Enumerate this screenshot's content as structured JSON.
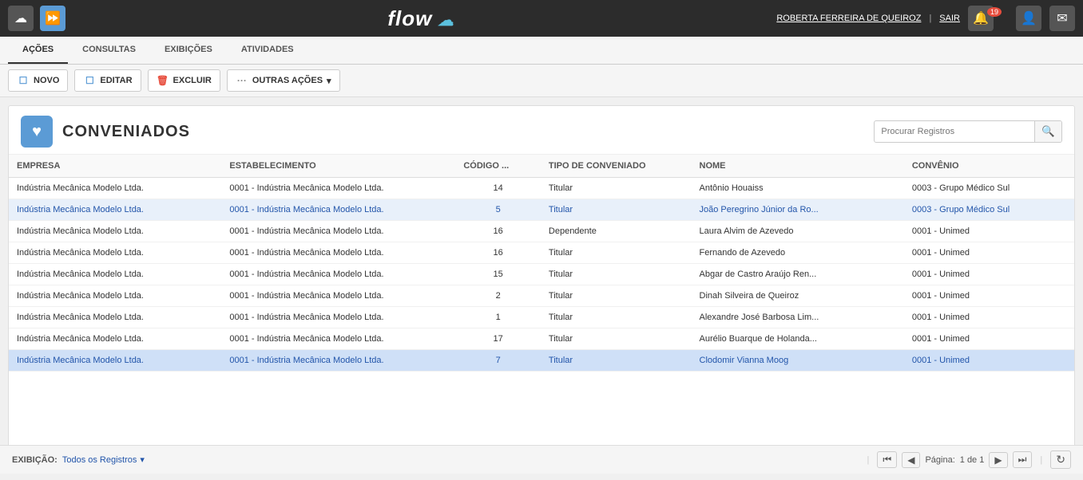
{
  "topbar": {
    "logo": "flow",
    "logo_icon": "☁",
    "user_name": "ROBERTA FERREIRA DE QUEIROZ",
    "sair_label": "SAIR",
    "notification_count": "19"
  },
  "nav": {
    "tabs": [
      {
        "label": "AÇÕES",
        "active": false
      },
      {
        "label": "CONSULTAS",
        "active": false
      },
      {
        "label": "EXIBIÇÕES",
        "active": false
      },
      {
        "label": "ATIVIDADES",
        "active": false
      }
    ]
  },
  "toolbar": {
    "novo_label": "NOVO",
    "editar_label": "EDITAR",
    "excluir_label": "EXCLUIR",
    "outras_acoes_label": "OUTRAS AÇÕES"
  },
  "page": {
    "icon": "♥",
    "title": "CONVENIADOS",
    "search_placeholder": "Procurar Registros"
  },
  "table": {
    "columns": [
      "EMPRESA",
      "ESTABELECIMENTO",
      "CÓDIGO ...",
      "TIPO DE CONVENIADO",
      "NOME",
      "CONVÊNIO"
    ],
    "rows": [
      {
        "empresa": "Indústria Mecânica Modelo Ltda.",
        "estabelecimento": "0001 - Indústria Mecânica Modelo Ltda.",
        "codigo": "14",
        "tipo": "Titular",
        "nome": "Antônio Houaiss",
        "convenio": "0003 - Grupo Médico Sul",
        "highlight": false,
        "selected": false
      },
      {
        "empresa": "Indústria Mecânica Modelo Ltda.",
        "estabelecimento": "0001 - Indústria Mecânica Modelo Ltda.",
        "codigo": "5",
        "tipo": "Titular",
        "nome": "João Peregrino Júnior da Ro...",
        "convenio": "0003 - Grupo Médico Sul",
        "highlight": true,
        "selected": false
      },
      {
        "empresa": "Indústria Mecânica Modelo Ltda.",
        "estabelecimento": "0001 - Indústria Mecânica Modelo Ltda.",
        "codigo": "16",
        "tipo": "Dependente",
        "nome": "Laura Alvim de Azevedo",
        "convenio": "0001 - Unimed",
        "highlight": false,
        "selected": false
      },
      {
        "empresa": "Indústria Mecânica Modelo Ltda.",
        "estabelecimento": "0001 - Indústria Mecânica Modelo Ltda.",
        "codigo": "16",
        "tipo": "Titular",
        "nome": "Fernando de Azevedo",
        "convenio": "0001 - Unimed",
        "highlight": false,
        "selected": false
      },
      {
        "empresa": "Indústria Mecânica Modelo Ltda.",
        "estabelecimento": "0001 - Indústria Mecânica Modelo Ltda.",
        "codigo": "15",
        "tipo": "Titular",
        "nome": "Abgar de Castro Araújo Ren...",
        "convenio": "0001 - Unimed",
        "highlight": false,
        "selected": false
      },
      {
        "empresa": "Indústria Mecânica Modelo Ltda.",
        "estabelecimento": "0001 - Indústria Mecânica Modelo Ltda.",
        "codigo": "2",
        "tipo": "Titular",
        "nome": "Dinah Silveira de Queiroz",
        "convenio": "0001 - Unimed",
        "highlight": false,
        "selected": false
      },
      {
        "empresa": "Indústria Mecânica Modelo Ltda.",
        "estabelecimento": "0001 - Indústria Mecânica Modelo Ltda.",
        "codigo": "1",
        "tipo": "Titular",
        "nome": "Alexandre José Barbosa Lim...",
        "convenio": "0001 - Unimed",
        "highlight": false,
        "selected": false
      },
      {
        "empresa": "Indústria Mecânica Modelo Ltda.",
        "estabelecimento": "0001 - Indústria Mecânica Modelo Ltda.",
        "codigo": "17",
        "tipo": "Titular",
        "nome": "Aurélio Buarque de Holanda...",
        "convenio": "0001 - Unimed",
        "highlight": false,
        "selected": false
      },
      {
        "empresa": "Indústria Mecânica Modelo Ltda.",
        "estabelecimento": "0001 - Indústria Mecânica Modelo Ltda.",
        "codigo": "7",
        "tipo": "Titular",
        "nome": "Clodomir Vianna Moog",
        "convenio": "0001 - Unimed",
        "highlight": false,
        "selected": true
      }
    ]
  },
  "footer": {
    "exibicao_label": "EXIBIÇÃO:",
    "view_label": "Todos os Registros",
    "page_label": "Página:",
    "page_current": "1 de 1"
  }
}
